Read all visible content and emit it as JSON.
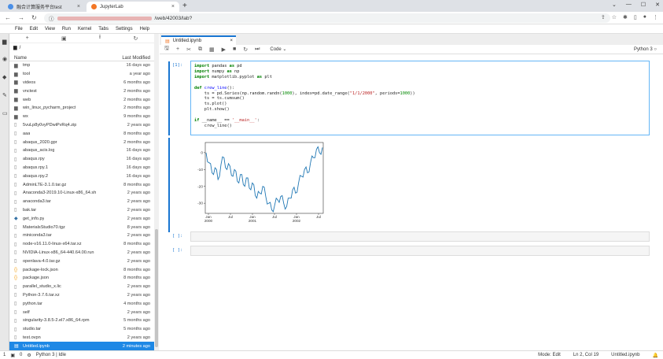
{
  "browser": {
    "tabs": [
      {
        "label": "融合计算服务平台test",
        "color": "#4a8fe7"
      },
      {
        "label": "JupyterLab",
        "color": "#f37726"
      }
    ],
    "new_tab": "+",
    "url": "/web/42003/lab?"
  },
  "menu": [
    "File",
    "Edit",
    "View",
    "Run",
    "Kernel",
    "Tabs",
    "Settings",
    "Help"
  ],
  "filebrowser": {
    "crumb": "/",
    "col_name": "Name",
    "col_modified": "Last Modified",
    "files": [
      {
        "name": "tmp",
        "modified": "16 days ago",
        "type": "folder"
      },
      {
        "name": "tool",
        "modified": "a year ago",
        "type": "folder"
      },
      {
        "name": "videos",
        "modified": "6 months ago",
        "type": "folder"
      },
      {
        "name": "vnctest",
        "modified": "2 months ago",
        "type": "folder"
      },
      {
        "name": "web",
        "modified": "2 months ago",
        "type": "folder"
      },
      {
        "name": "win_linux_pycharm_project",
        "modified": "2 months ago",
        "type": "folder"
      },
      {
        "name": "wx",
        "modified": "9 months ago",
        "type": "folder"
      },
      {
        "name": "5vuLp8y0vyPDwiPvRq4.zip",
        "modified": "2 years ago",
        "type": "file"
      },
      {
        "name": "aaa",
        "modified": "8 months ago",
        "type": "file"
      },
      {
        "name": "abaqus_2020.gpr",
        "modified": "2 months ago",
        "type": "file"
      },
      {
        "name": "abaqus_acis.log",
        "modified": "16 days ago",
        "type": "file"
      },
      {
        "name": "abaqus.rpy",
        "modified": "16 days ago",
        "type": "file"
      },
      {
        "name": "abaqus.rpy.1",
        "modified": "16 days ago",
        "type": "file"
      },
      {
        "name": "abaqus.rpy.2",
        "modified": "16 days ago",
        "type": "file"
      },
      {
        "name": "AdminLTE-3.1.0.tar.gz",
        "modified": "8 months ago",
        "type": "file"
      },
      {
        "name": "Anaconda3-2019.10-Linux-x86_64.sh",
        "modified": "2 years ago",
        "type": "file"
      },
      {
        "name": "anaconda3.tar",
        "modified": "2 years ago",
        "type": "file"
      },
      {
        "name": "bak.tar",
        "modified": "2 years ago",
        "type": "file"
      },
      {
        "name": "get_info.py",
        "modified": "2 years ago",
        "type": "py"
      },
      {
        "name": "MaterialsStudio70.tgz",
        "modified": "8 years ago",
        "type": "file"
      },
      {
        "name": "miniconda3.tar",
        "modified": "2 years ago",
        "type": "file"
      },
      {
        "name": "node-v16.11.0-linux-x64.tar.xz",
        "modified": "8 months ago",
        "type": "file"
      },
      {
        "name": "NVIDIA-Linux-x86_64-440.64.00.run",
        "modified": "2 years ago",
        "type": "file"
      },
      {
        "name": "openlava-4.0.tar.gz",
        "modified": "2 years ago",
        "type": "file"
      },
      {
        "name": "package-lock.json",
        "modified": "8 months ago",
        "type": "json"
      },
      {
        "name": "package.json",
        "modified": "8 months ago",
        "type": "json"
      },
      {
        "name": "parallel_studio_x.lic",
        "modified": "2 years ago",
        "type": "file"
      },
      {
        "name": "Python-3.7.6.tar.xz",
        "modified": "2 years ago",
        "type": "file"
      },
      {
        "name": "python.tar",
        "modified": "4 months ago",
        "type": "file"
      },
      {
        "name": "self",
        "modified": "2 years ago",
        "type": "file"
      },
      {
        "name": "singularity-3.8.5-2.el7.x86_64.rpm",
        "modified": "5 months ago",
        "type": "file"
      },
      {
        "name": "studio.tar",
        "modified": "5 months ago",
        "type": "file"
      },
      {
        "name": "test.ovpn",
        "modified": "2 years ago",
        "type": "file"
      },
      {
        "name": "Untitled.ipynb",
        "modified": "2 minutes ago",
        "type": "notebook",
        "selected": true
      }
    ]
  },
  "notebook": {
    "tab_title": "Untitled.ipynb",
    "cell_type": "Code",
    "kernel": "Python 3",
    "prompt1": "[1]:",
    "prompt_empty": "[ ]:"
  },
  "chart_data": {
    "type": "line",
    "x_ticks": [
      "Jan\n2000",
      "Jul",
      "Jan\n2001",
      "Jul",
      "Jan\n2002",
      "Jul"
    ],
    "y_ticks": [
      0,
      -10,
      -20,
      -30
    ],
    "ylim": [
      -36,
      6
    ],
    "series": [
      {
        "values": [
          0,
          -6,
          -12,
          -9,
          -16,
          -7,
          -3,
          -10,
          -8,
          -14,
          -11,
          -18,
          -13,
          -20,
          -15,
          -22,
          -19,
          -27,
          -24,
          -20,
          -26,
          -30,
          -34,
          -31,
          -28,
          -26,
          -30,
          -32,
          -27,
          -22,
          -24,
          -18,
          -14,
          -10,
          -12,
          -6,
          -3,
          2,
          0,
          3
        ]
      }
    ],
    "color": "#1f77b4"
  },
  "status": {
    "left": "Python 3 | Idle",
    "mode": "Mode: Edit",
    "pos": "Ln 2, Col 19",
    "file": "Untitled.ipynb",
    "count1": "1",
    "count2": "0"
  }
}
